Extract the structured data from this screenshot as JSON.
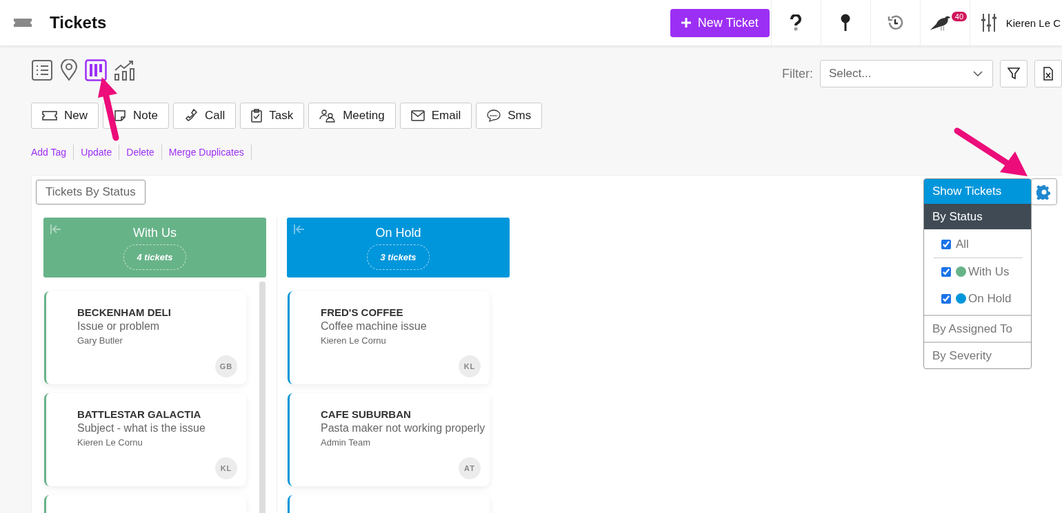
{
  "header": {
    "title": "Tickets",
    "new_button": "New Ticket",
    "notification_count": "40",
    "user_name": "Kieren Le C"
  },
  "views": [
    {
      "kind": "list",
      "selected": false
    },
    {
      "kind": "map",
      "selected": false
    },
    {
      "kind": "board",
      "selected": true
    },
    {
      "kind": "chart",
      "selected": false
    }
  ],
  "filter": {
    "label": "Filter:",
    "placeholder": "Select..."
  },
  "actions": [
    {
      "kind": "ticket",
      "label": "New"
    },
    {
      "kind": "note",
      "label": "Note"
    },
    {
      "kind": "call",
      "label": "Call"
    },
    {
      "kind": "task",
      "label": "Task"
    },
    {
      "kind": "meeting",
      "label": "Meeting"
    },
    {
      "kind": "email",
      "label": "Email"
    },
    {
      "kind": "sms",
      "label": "Sms"
    }
  ],
  "bulk_actions": [
    "Add Tag",
    "Update",
    "Delete",
    "Merge Duplicates"
  ],
  "board": {
    "title": "Tickets By Status",
    "columns": [
      {
        "name": "With Us",
        "count": "4 tickets",
        "color": "#67b388",
        "cards": [
          {
            "title": "BECKENHAM DELI",
            "subject": "Issue or problem",
            "assignee": "Gary Butler",
            "initials": "GB"
          },
          {
            "title": "BATTLESTAR GALACTIA",
            "subject": "Subject - what is the issue",
            "assignee": "Kieren Le Cornu",
            "initials": "KL"
          }
        ]
      },
      {
        "name": "On Hold",
        "count": "3 tickets",
        "color": "#0096db",
        "cards": [
          {
            "title": "FRED'S COFFEE",
            "subject": "Coffee machine issue",
            "assignee": "Kieren Le Cornu",
            "initials": "KL"
          },
          {
            "title": "CAFE SUBURBAN",
            "subject": "Pasta maker not working properly",
            "assignee": "Admin Team",
            "initials": "AT"
          }
        ]
      }
    ]
  },
  "show_menu": {
    "title": "Show Tickets",
    "sections": [
      {
        "label": "By Status",
        "expanded": true,
        "options": [
          {
            "kind": "all",
            "label": "All",
            "checked": true
          },
          {
            "kind": "status",
            "label": "With Us",
            "checked": true,
            "color": "#67b388"
          },
          {
            "kind": "status",
            "label": "On Hold",
            "checked": true,
            "color": "#0096db"
          }
        ]
      },
      {
        "label": "By Assigned To",
        "expanded": false
      },
      {
        "label": "By Severity",
        "expanded": false
      }
    ]
  }
}
